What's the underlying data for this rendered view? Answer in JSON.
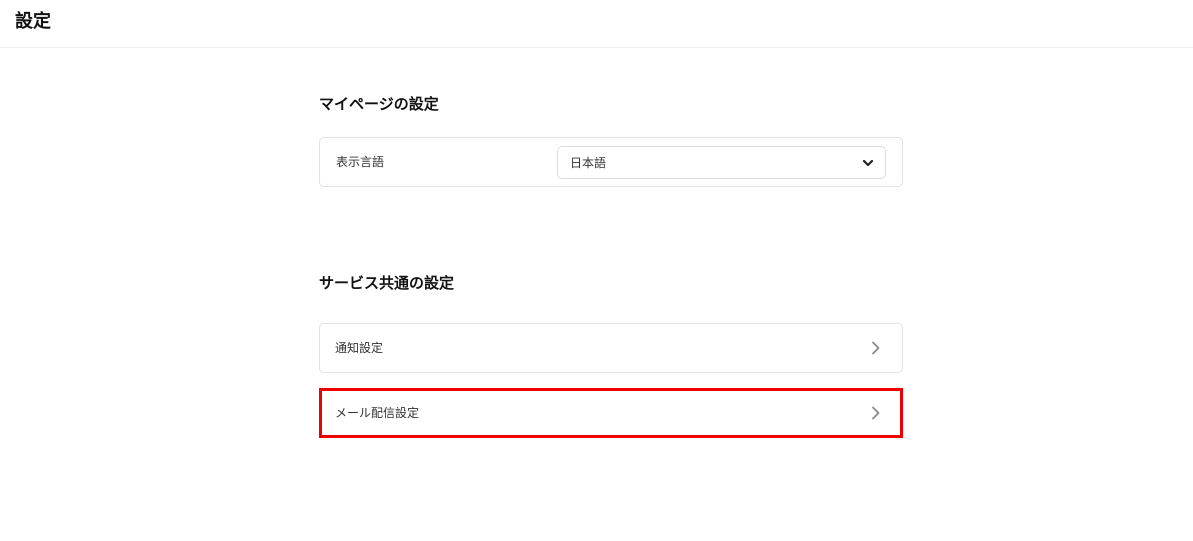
{
  "header": {
    "title": "設定"
  },
  "mypage_section": {
    "title": "マイページの設定",
    "language": {
      "label": "表示言語",
      "selected": "日本語",
      "icon": "chevron-down-icon"
    }
  },
  "common_section": {
    "title": "サービス共通の設定",
    "items": [
      {
        "label": "通知設定",
        "icon": "chevron-right-icon"
      },
      {
        "label": "メール配信設定",
        "icon": "chevron-right-icon"
      }
    ]
  },
  "colors": {
    "highlight": "#ee0000",
    "border": "#e2e2e2",
    "text": "#222222"
  }
}
